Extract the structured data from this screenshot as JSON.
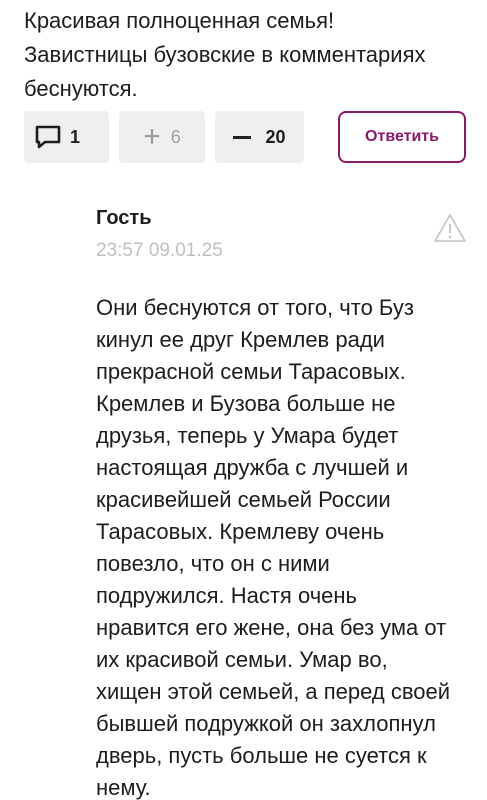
{
  "comment": {
    "text": "Красивая полноценная семья!\nЗавистницы бузовские в комментариях\nбеснуются."
  },
  "actions": {
    "replies_count": "1",
    "plus_icon": "plus-icon",
    "plus_count": "6",
    "minus_icon": "minus-icon",
    "minus_count": "20",
    "reply_label": "Ответить",
    "comment_icon": "comment-bubble-icon"
  },
  "reply": {
    "author": "Гость",
    "timestamp": "23:57 09.01.25",
    "report_icon": "warning-triangle-icon",
    "text": "Они беснуются от того, что Буз\nкинул ее друг Кремлев ради\nпрекрасной семьи Тарасовых.\nКремлев и Бузова больше не\nдрузья, теперь у Умара будет\nнастоящая дружба с лучшей и\nкрасивейшей семьей России\nТарасовых. Кремлеву очень\nповезло, что он с ними\nподружился. Настя очень\nнравится его жене, она без ума от\nих красивой семьи. Умар во,\nхищен этой семьей, а перед своей\nбывшей подружкой он захлопнул\nдверь, пусть больше не суется к\nнему."
  },
  "colors": {
    "accent": "#8b1a6b",
    "pill_bg": "#efefef",
    "muted_text": "#c0c0c0"
  }
}
